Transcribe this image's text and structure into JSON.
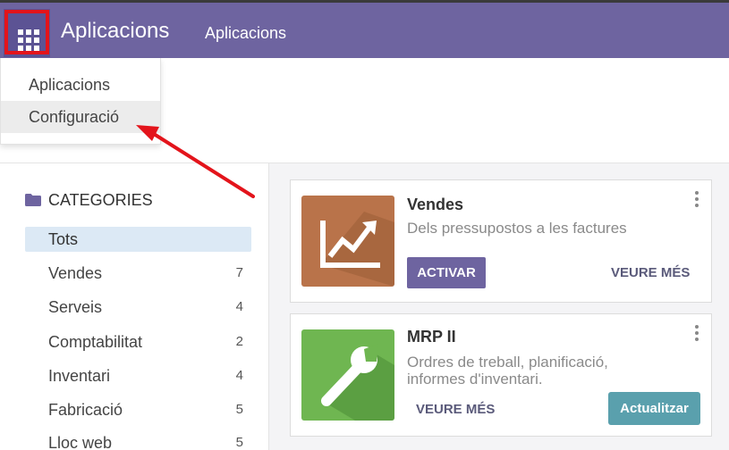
{
  "header": {
    "brand": "Aplicacions",
    "menu_item": "Aplicacions"
  },
  "dropdown": {
    "items": [
      "Aplicacions",
      "Configuració"
    ]
  },
  "sidebar": {
    "title": "CATEGORIES",
    "items": [
      {
        "name": "Tots",
        "count": ""
      },
      {
        "name": "Vendes",
        "count": "7"
      },
      {
        "name": "Serveis",
        "count": "4"
      },
      {
        "name": "Comptabilitat",
        "count": "2"
      },
      {
        "name": "Inventari",
        "count": "4"
      },
      {
        "name": "Fabricació",
        "count": "5"
      },
      {
        "name": "Lloc web",
        "count": "5"
      }
    ]
  },
  "apps": [
    {
      "name": "Vendes",
      "description": "Dels pressupostos a les factures",
      "primary_action": "ACTIVAR",
      "secondary_action": "VEURE MÉS",
      "icon": "chart-up-icon",
      "color": "#b9734a"
    },
    {
      "name": "MRP II",
      "description_line1": "Ordres de treball, planificació,",
      "description_line2": "informes d'inventari.",
      "secondary_action": "VEURE MÉS",
      "primary_action": "Actualitzar",
      "icon": "wrench-icon",
      "color": "#6fb651"
    }
  ],
  "colors": {
    "topbar": "#6e64a0",
    "highlight": "#e3141b",
    "active_category": "#dce9f5"
  }
}
